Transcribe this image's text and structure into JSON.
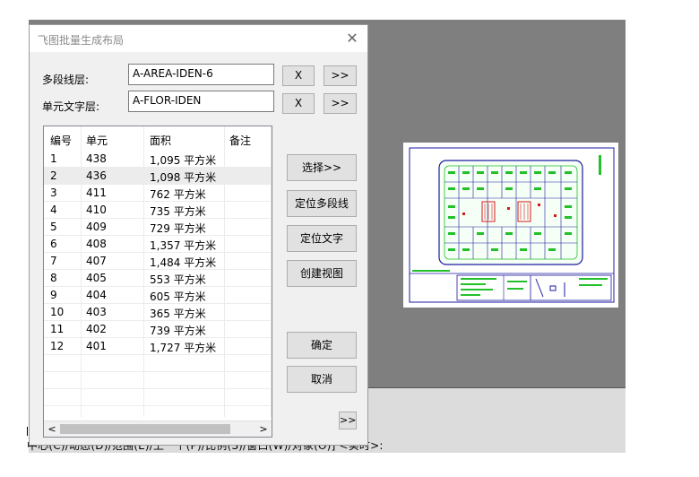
{
  "dialog": {
    "title": "飞图批量生成布局",
    "close_symbol": "✕"
  },
  "polyline_layer": {
    "label": "多段线层:",
    "value": "A-AREA-IDEN-6"
  },
  "text_layer": {
    "label": "单元文字层:",
    "value": "A-FLOR-IDEN"
  },
  "buttons": {
    "clear_symbol": "X",
    "more_symbol": ">>",
    "select": "选择>>",
    "locate_polyline": "定位多段线",
    "locate_text": "定位文字",
    "create_view": "创建视图",
    "ok": "确定",
    "cancel": "取消",
    "expand": ">>"
  },
  "table": {
    "columns": [
      "编号",
      "单元",
      "面积",
      "备注"
    ],
    "selected_row": 1,
    "rows": [
      [
        "1",
        "438",
        "1,095 平方米",
        ""
      ],
      [
        "2",
        "436",
        "1,098 平方米",
        ""
      ],
      [
        "3",
        "411",
        "762 平方米",
        ""
      ],
      [
        "4",
        "410",
        "735 平方米",
        ""
      ],
      [
        "5",
        "409",
        "729 平方米",
        ""
      ],
      [
        "6",
        "408",
        "1,357 平方米",
        ""
      ],
      [
        "7",
        "407",
        "1,484 平方米",
        ""
      ],
      [
        "8",
        "405",
        "553 平方米",
        ""
      ],
      [
        "9",
        "404",
        "605 平方米",
        ""
      ],
      [
        "10",
        "403",
        "365 平方米",
        ""
      ],
      [
        "11",
        "402",
        "739 平方米",
        ""
      ],
      [
        "12",
        "401",
        "1,727 平方米",
        ""
      ]
    ]
  },
  "scrollbar": {
    "left_arrow": "<",
    "right_arrow": ">"
  },
  "command_line": {
    "text": "中心(C)/动态(D)/范围(E)/上一个(P)/比例(S)/窗口(W)/对象(O)] <实时>:"
  },
  "colors": {
    "cad_background": "#7f7f7f",
    "command_background": "#dcdcdc",
    "drawing_frame": "#1a1aa0",
    "drawing_green": "#22c02a",
    "drawing_red": "#d21a1a"
  }
}
